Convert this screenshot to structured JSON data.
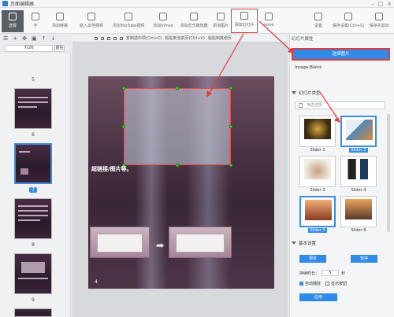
{
  "app": {
    "title": "页面编辑器"
  },
  "toolbar": {
    "buttons": [
      {
        "label": "选择",
        "icon": "cursor-icon"
      },
      {
        "label": "手",
        "icon": "hand-icon"
      },
      {
        "label": "添加链接",
        "icon": "link-icon"
      },
      {
        "label": "嵌入本地视频",
        "icon": "film-icon"
      },
      {
        "label": "添加YouTube视频",
        "icon": "youtube-icon"
      },
      {
        "label": "添加Vimeo",
        "icon": "vimeo-icon"
      },
      {
        "label": "添加音乐播放器",
        "icon": "music-icon"
      },
      {
        "label": "添加图片",
        "icon": "image-icon"
      },
      {
        "label": "添加幻灯片",
        "icon": "slideshow-icon"
      },
      {
        "label": "more",
        "icon": "more-icon"
      },
      {
        "label": "设置",
        "icon": "gear-icon"
      },
      {
        "label": "保存设置(Ctrl+S)",
        "icon": "save-icon"
      },
      {
        "label": "保存并退出",
        "icon": "save-exit-icon"
      }
    ]
  },
  "pager": {
    "value": "7/26",
    "go": "前往"
  },
  "thumbnails": [
    {
      "num": "5"
    },
    {
      "num": "6"
    },
    {
      "num": "7",
      "selected": true
    },
    {
      "num": "8"
    },
    {
      "num": "9"
    }
  ],
  "canvas_toolbar": {
    "copy": "复制选中项(Ctrl+C)",
    "paste_page": "粘贴到当前页(Ctrl+V)",
    "paste_other": "粘贴到其他页"
  },
  "slide": {
    "text": "超链接/图片等。",
    "page": "4"
  },
  "right_panel": {
    "tab": "幻灯片属性",
    "choose_image": "选择图片",
    "image_label": "Image:Blank",
    "slider_type_title": "幻灯片类型",
    "filter_placeholder": "筛选选择",
    "sliders": [
      {
        "label": "Slider 1"
      },
      {
        "label": "Slider 2",
        "selected": true
      },
      {
        "label": "Slider 3"
      },
      {
        "label": "Slider 4"
      },
      {
        "label": "Slider 5"
      },
      {
        "label": "Slider 6"
      }
    ],
    "basic_title": "基本设置",
    "preview": "预览",
    "pause": "暂停",
    "duration_label": "持续时长：",
    "duration_value": "5",
    "duration_unit": "秒",
    "autoplay": "自动播放",
    "show_buttons": "显示按钮",
    "apply": "应用"
  },
  "colors": {
    "accent": "#2f8be6",
    "highlight": "#e43b3b",
    "handle": "#3fd13f"
  }
}
